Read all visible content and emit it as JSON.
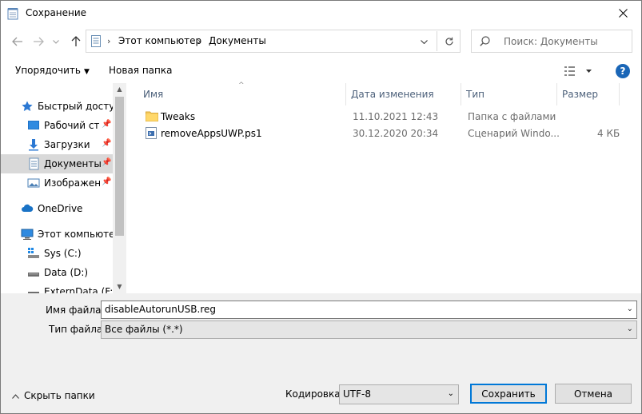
{
  "window": {
    "title": "Сохранение"
  },
  "navigation": {
    "back_icon": "arrow-left-icon",
    "forward_icon": "arrow-right-icon",
    "recent_icon": "chevron-down-icon",
    "up_icon": "arrow-up-icon",
    "breadcrumbs": [
      "Этот компьютер",
      "Документы"
    ],
    "search_placeholder": "Поиск: Документы"
  },
  "toolbar": {
    "organize_label": "Упорядочить",
    "new_folder_label": "Новая папка"
  },
  "sidebar": {
    "items": [
      {
        "label": "Быстрый доступ",
        "icon": "star-icon"
      },
      {
        "label": "Рабочий сто.",
        "icon": "desktop-icon",
        "pinned": true
      },
      {
        "label": "Загрузки",
        "icon": "download-icon",
        "pinned": true
      },
      {
        "label": "Документы",
        "icon": "documents-icon",
        "pinned": true,
        "selected": true
      },
      {
        "label": "Изображени",
        "icon": "pictures-icon",
        "pinned": true
      },
      {
        "label": "OneDrive",
        "icon": "cloud-icon"
      },
      {
        "label": "Этот компьютер",
        "icon": "computer-icon"
      },
      {
        "label": "Sys (C:)",
        "icon": "drive-icon"
      },
      {
        "label": "Data (D:)",
        "icon": "drive-icon"
      },
      {
        "label": "ExternData (F:)",
        "icon": "drive-icon"
      }
    ]
  },
  "columns": {
    "name": "Имя",
    "date": "Дата изменения",
    "type": "Тип",
    "size": "Размер"
  },
  "files": [
    {
      "name": "Tweaks",
      "date": "11.10.2021 12:43",
      "type": "Папка с файлами",
      "size": "",
      "icon": "folder-icon"
    },
    {
      "name": "removeAppsUWP.ps1",
      "date": "30.12.2020 20:34",
      "type": "Сценарий Windo...",
      "size": "4 КБ",
      "icon": "script-icon"
    }
  ],
  "form": {
    "filename_label": "Имя файла:",
    "filename_value": "disableAutorunUSB.reg",
    "filetype_label": "Тип файла:",
    "filetype_value": "Все файлы  (*.*)",
    "hide_folders_label": "Скрыть папки",
    "encoding_label": "Кодировка:",
    "encoding_value": "UTF-8",
    "save_label": "Сохранить",
    "cancel_label": "Отмена"
  },
  "colors": {
    "accent": "#0078d7",
    "selection": "#d9d9d9",
    "header_text": "#4c607a"
  }
}
